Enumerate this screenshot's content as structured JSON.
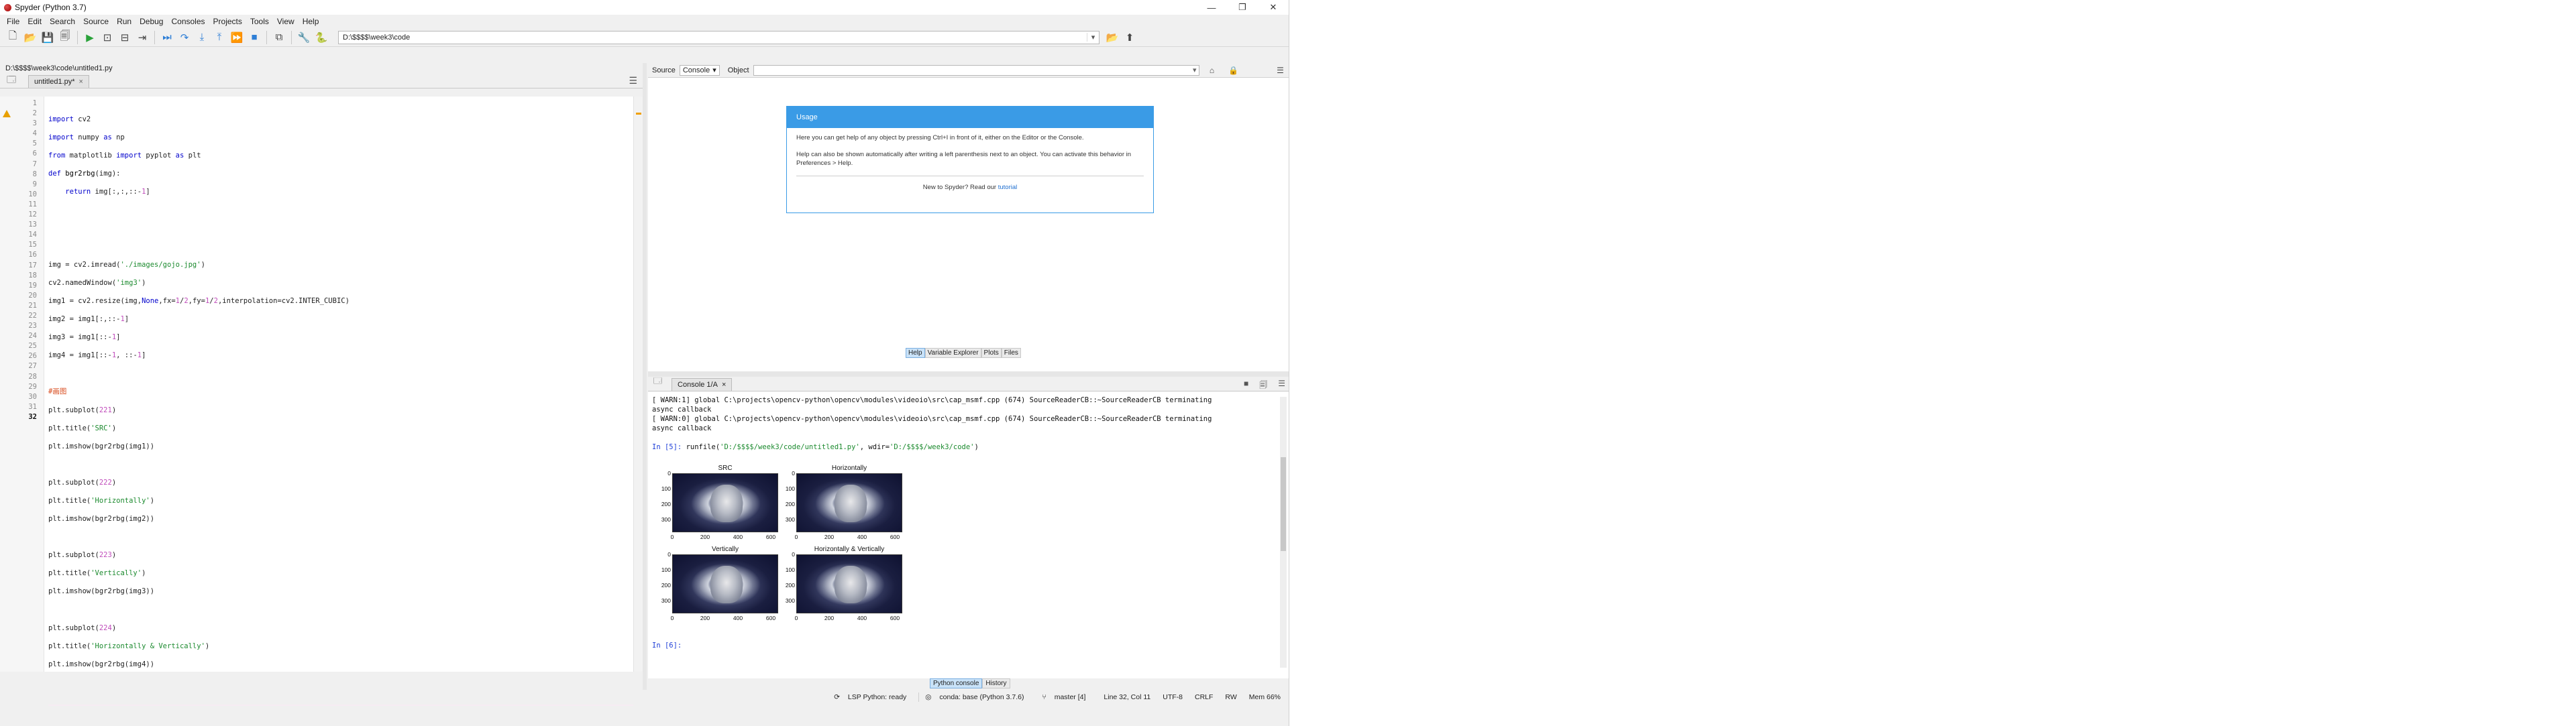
{
  "window": {
    "title": "Spyder (Python 3.7)",
    "min": "—",
    "max": "❐",
    "close": "✕"
  },
  "menu": [
    "File",
    "Edit",
    "Search",
    "Source",
    "Run",
    "Debug",
    "Consoles",
    "Projects",
    "Tools",
    "View",
    "Help"
  ],
  "toolbar": {
    "working_dir": "D:\\$$$$\\week3\\code"
  },
  "editor": {
    "file_path": "D:\\$$$$\\week3\\code\\untitled1.py",
    "tab_label": "untitled1.py*",
    "tab_close": "×",
    "line_numbers": [
      "1",
      "2",
      "3",
      "4",
      "5",
      "6",
      "7",
      "8",
      "9",
      "10",
      "11",
      "12",
      "13",
      "14",
      "15",
      "16",
      "17",
      "18",
      "19",
      "20",
      "21",
      "22",
      "23",
      "24",
      "25",
      "26",
      "27",
      "28",
      "29",
      "30",
      "31",
      "32"
    ],
    "current_line": "32"
  },
  "help": {
    "source_label": "Source",
    "source_value": "Console",
    "object_label": "Object",
    "usage_title": "Usage",
    "usage_p1": "Here you can get help of any object by pressing Ctrl+I in front of it, either on the Editor or the Console.",
    "usage_p2": "Help can also be shown automatically after writing a left parenthesis next to an object. You can activate this behavior in Preferences > Help.",
    "new_prefix": "New to Spyder? Read our ",
    "new_link": "tutorial",
    "tabs": [
      "Help",
      "Variable Explorer",
      "Plots",
      "Files"
    ]
  },
  "console": {
    "tab_label": "Console 1/A",
    "tab_close": "×",
    "warn1": "[ WARN:1] global C:\\projects\\opencv-python\\opencv\\modules\\videoio\\src\\cap_msmf.cpp (674) SourceReaderCB::~SourceReaderCB terminating",
    "warn1b": "async callback",
    "warn0": "[ WARN:0] global C:\\projects\\opencv-python\\opencv\\modules\\videoio\\src\\cap_msmf.cpp (674) SourceReaderCB::~SourceReaderCB terminating",
    "warn0b": "async callback",
    "prompt5": "In [5]: ",
    "run_cmd_a": "runfile(",
    "run_arg1": "'D:/$$$$/week3/code/untitled1.py'",
    "run_cmd_b": ", wdir=",
    "run_arg2": "'D:/$$$$/week3/code'",
    "run_cmd_c": ")",
    "prompt6": "In [6]: ",
    "bottom_tabs": [
      "Python console",
      "History"
    ]
  },
  "figure": {
    "titles": [
      "SRC",
      "Horizontally",
      "Vertically",
      "Horizontally & Vertically"
    ],
    "yticks": [
      "0",
      "100",
      "200",
      "300"
    ],
    "xticks": [
      "0",
      "200",
      "400",
      "600"
    ]
  },
  "status": {
    "lsp": "LSP Python: ready",
    "conda": "conda: base (Python 3.7.6)",
    "git": "master [4]",
    "position": "Line 32, Col 11",
    "encoding": "UTF-8",
    "eol": "CRLF",
    "rw": "RW",
    "mem": "Mem 66%"
  }
}
